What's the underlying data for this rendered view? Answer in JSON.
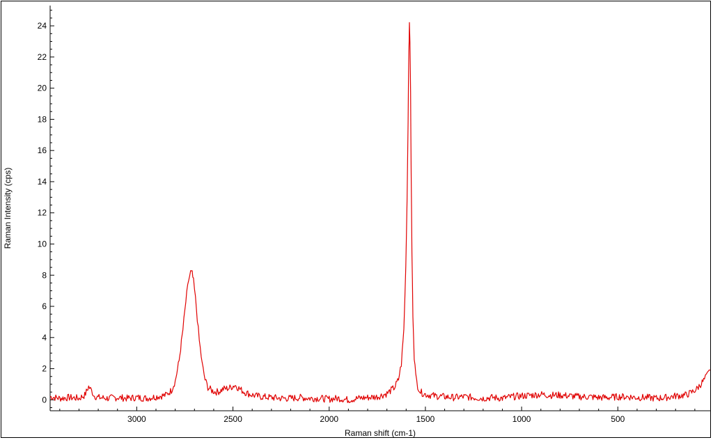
{
  "chart_data": {
    "type": "line",
    "xlabel": "Raman shift (cm-1)",
    "ylabel": "Raman Intensity (cps)",
    "xlim": [
      3450,
      20
    ],
    "ylim": [
      -0.7,
      25.3
    ],
    "x_inverted": true,
    "xticks": [
      3000,
      2500,
      2000,
      1500,
      1000,
      500
    ],
    "yticks": [
      0,
      2,
      4,
      6,
      8,
      10,
      12,
      14,
      16,
      18,
      20,
      22,
      24
    ],
    "grid": false,
    "series_color": "#e00000",
    "series": [
      {
        "x": [
          3450,
          3400,
          3350,
          3300,
          3270,
          3250,
          3235,
          3220,
          3200,
          3150,
          3100,
          3050,
          3000,
          2950,
          2900,
          2850,
          2820,
          2800,
          2780,
          2760,
          2745,
          2730,
          2720,
          2712,
          2705,
          2695,
          2685,
          2675,
          2660,
          2645,
          2630,
          2610,
          2590,
          2570,
          2550,
          2520,
          2490,
          2465,
          2440,
          2410,
          2380,
          2350,
          2300,
          2250,
          2200,
          2150,
          2100,
          2050,
          2000,
          1950,
          1900,
          1850,
          1800,
          1750,
          1700,
          1660,
          1640,
          1625,
          1612,
          1602,
          1595,
          1590,
          1586,
          1583,
          1580,
          1577,
          1574,
          1570,
          1565,
          1558,
          1550,
          1540,
          1525,
          1500,
          1450,
          1400,
          1350,
          1300,
          1250,
          1200,
          1150,
          1100,
          1050,
          1000,
          950,
          900,
          850,
          800,
          750,
          700,
          650,
          600,
          550,
          500,
          450,
          400,
          350,
          300,
          250,
          200,
          150,
          120,
          90,
          70,
          50,
          35,
          20
        ],
        "values": [
          0.2,
          0.1,
          0.15,
          0.1,
          0.3,
          0.85,
          0.6,
          0.25,
          0.15,
          0.1,
          0.15,
          0.1,
          0.15,
          0.1,
          0.2,
          0.3,
          0.6,
          1.2,
          2.5,
          4.5,
          6.3,
          7.7,
          8.2,
          8.1,
          7.6,
          6.5,
          5.2,
          3.8,
          2.3,
          1.3,
          0.8,
          0.6,
          0.5,
          0.55,
          0.7,
          0.75,
          0.95,
          0.7,
          0.5,
          0.35,
          0.25,
          0.2,
          0.15,
          0.1,
          0.1,
          0.15,
          0.1,
          0.1,
          0.05,
          0.1,
          0.0,
          0.1,
          0.15,
          0.2,
          0.4,
          0.8,
          1.3,
          2.3,
          4.5,
          8.5,
          13.0,
          18.0,
          22.5,
          24.0,
          23.0,
          19.5,
          14.5,
          9.5,
          5.5,
          2.8,
          1.5,
          0.9,
          0.5,
          0.35,
          0.25,
          0.2,
          0.15,
          0.2,
          0.15,
          0.1,
          0.15,
          0.1,
          0.2,
          0.25,
          0.3,
          0.35,
          0.3,
          0.3,
          0.25,
          0.2,
          0.2,
          0.15,
          0.15,
          0.2,
          0.2,
          0.15,
          0.15,
          0.1,
          0.15,
          0.25,
          0.3,
          0.45,
          0.7,
          1.0,
          1.3,
          1.6,
          1.9
        ]
      }
    ]
  }
}
